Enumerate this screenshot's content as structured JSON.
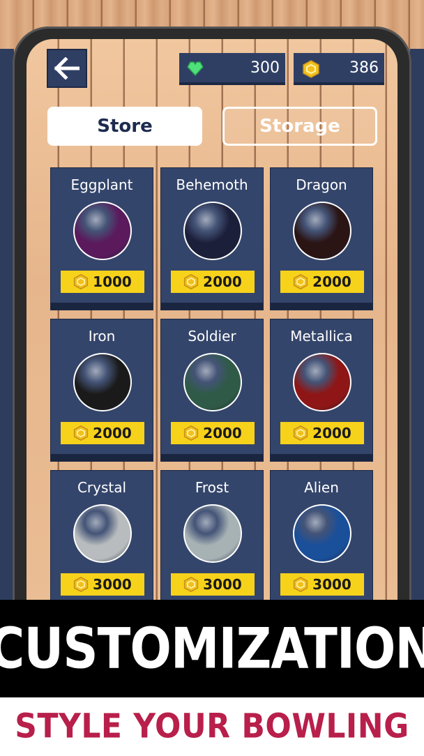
{
  "header": {
    "back_icon": "arrow-left-icon",
    "gems": {
      "icon": "heart-gem-icon",
      "value": "300",
      "color": "#4ee07a"
    },
    "coins": {
      "icon": "coin-icon",
      "value": "386",
      "color": "#f2c01d"
    }
  },
  "tabs": [
    {
      "label": "Store",
      "active": true
    },
    {
      "label": "Storage",
      "active": false
    }
  ],
  "store_items": [
    {
      "name": "Eggplant",
      "price": "1000",
      "ball_color": "#5a1a5c"
    },
    {
      "name": "Behemoth",
      "price": "2000",
      "ball_color": "#1c1f3a"
    },
    {
      "name": "Dragon",
      "price": "2000",
      "ball_color": "#2a1414"
    },
    {
      "name": "Iron",
      "price": "2000",
      "ball_color": "#1a1a1a"
    },
    {
      "name": "Soldier",
      "price": "2000",
      "ball_color": "#2f5a47"
    },
    {
      "name": "Metallica",
      "price": "2000",
      "ball_color": "#8e1616"
    },
    {
      "name": "Crystal",
      "price": "3000",
      "ball_color": "#b8bcbe"
    },
    {
      "name": "Frost",
      "price": "3000",
      "ball_color": "#a7b2b5"
    },
    {
      "name": "Alien",
      "price": "3000",
      "ball_color": "#1a4f9a"
    }
  ],
  "promo": {
    "headline": "CUSTOMIZATION",
    "subheadline": "STYLE YOUR BOWLING"
  },
  "colors": {
    "panel": "#34456b",
    "price_tag": "#f7d21b",
    "subheadline": "#b81f4a"
  }
}
